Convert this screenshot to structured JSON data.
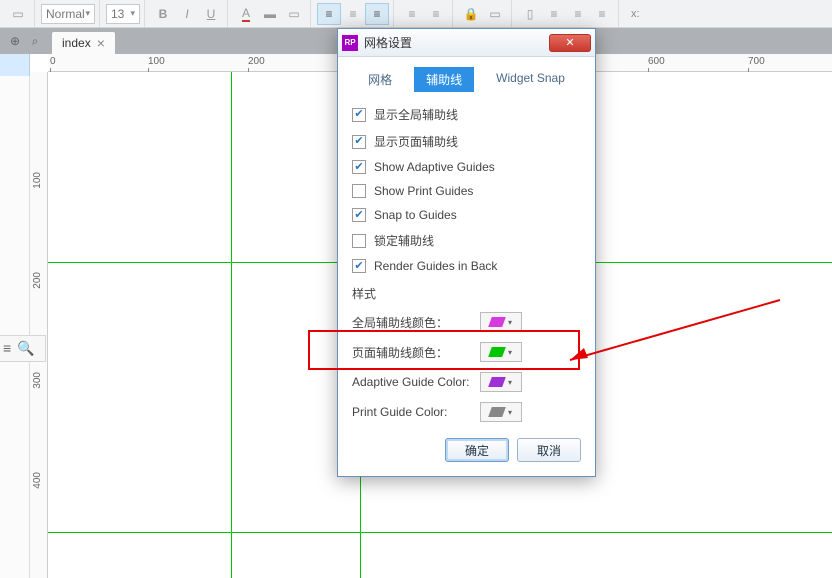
{
  "toolbar": {
    "style_select": "Normal",
    "font_size": "13",
    "x_label": "x:"
  },
  "tab": {
    "name": "index"
  },
  "ruler_h": [
    "0",
    "100",
    "200",
    "600",
    "700"
  ],
  "ruler_v": [
    "100",
    "200",
    "300",
    "400"
  ],
  "dialog": {
    "title": "网格设置",
    "logo": "RP",
    "tabs": {
      "grid": "网格",
      "guides": "辅助线",
      "widget": "Widget Snap"
    },
    "checks": {
      "show_global": "显示全局辅助线",
      "show_page": "显示页面辅助线",
      "show_adaptive": "Show Adaptive Guides",
      "show_print": "Show Print Guides",
      "snap": "Snap to Guides",
      "lock": "锁定辅助线",
      "render_back": "Render Guides in Back"
    },
    "style_label": "样式",
    "global_color_label": "全局辅助线颜色：",
    "page_color_label": "页面辅助线颜色：",
    "adaptive_color_label": "Adaptive Guide Color:",
    "print_color_label": "Print Guide Color:",
    "colors": {
      "global": "#d63adf",
      "page": "#00c600",
      "adaptive": "#a030d6",
      "print": "#888888"
    },
    "buttons": {
      "ok": "确定",
      "cancel": "取消"
    }
  }
}
